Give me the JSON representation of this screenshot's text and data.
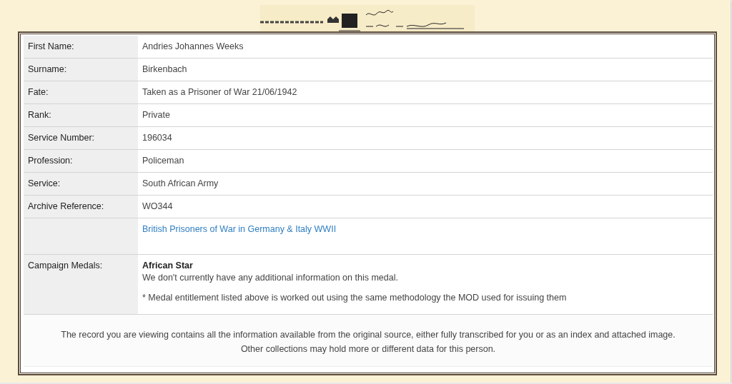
{
  "record": {
    "rows": [
      {
        "kind": "field",
        "label": "First Name:",
        "value": "Andries Johannes Weeks"
      },
      {
        "kind": "field",
        "label": "Surname:",
        "value": "Birkenbach"
      },
      {
        "kind": "field",
        "label": "Fate:",
        "value": "Taken as a Prisoner of War 21/06/1942"
      },
      {
        "kind": "field",
        "label": "Rank:",
        "value": "Private"
      },
      {
        "kind": "field",
        "label": "Service Number:",
        "value": "196034"
      },
      {
        "kind": "field",
        "label": "Profession:",
        "value": "Policeman"
      },
      {
        "kind": "field",
        "label": "Service:",
        "value": "South African Army"
      },
      {
        "kind": "field",
        "label": "Archive Reference:",
        "value": "WO344"
      },
      {
        "kind": "link",
        "value": "British Prisoners of War in Germany & Italy WWII"
      },
      {
        "kind": "medals",
        "label": "Campaign Medals:",
        "medal": "African Star",
        "info": "We don't currently have any additional information on this medal.",
        "note": "* Medal entitlement listed above is worked out using the same methodology the MOD used for issuing them"
      }
    ]
  },
  "footer": [
    "The record you are viewing contains all the information available from the original source, either fully transcribed for you or as an index and attached image.",
    "Other collections may hold more or different data for this person."
  ]
}
